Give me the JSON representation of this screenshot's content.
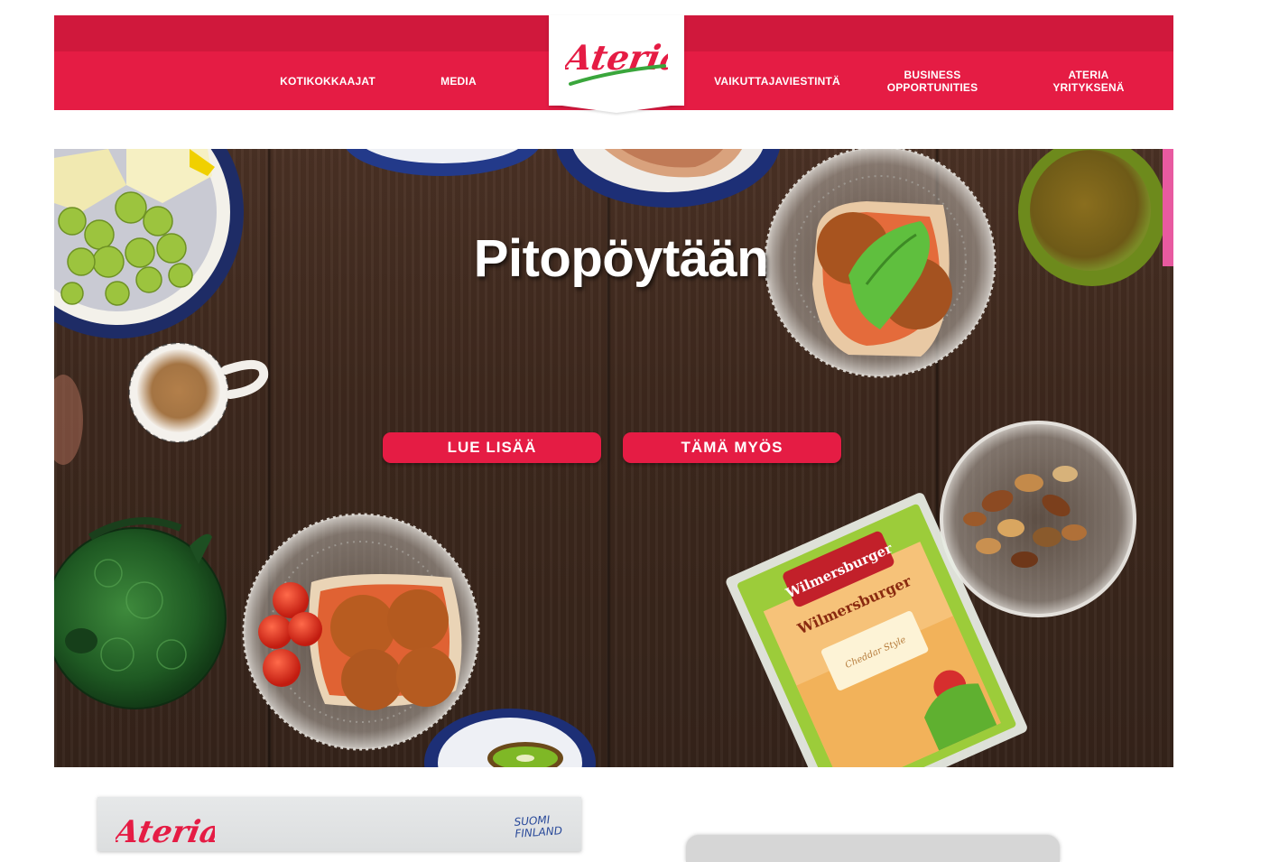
{
  "header": {
    "logo_text": "Ateria",
    "nav_left": [
      {
        "lines": [
          "KOTIKOKKAAJAT"
        ]
      },
      {
        "lines": [
          "MEDIA"
        ]
      }
    ],
    "nav_right": [
      {
        "lines": [
          "VAIKUTTAJAVIESTINTÄ"
        ]
      },
      {
        "lines": [
          "BUSINESS",
          "OPPORTUNITIES"
        ]
      },
      {
        "lines": [
          "ATERIA",
          "YRITYKSENÄ"
        ]
      }
    ],
    "brand_color": "#e51c44",
    "brand_color_dark": "#d0183c"
  },
  "hero": {
    "title": "Pitopöytään",
    "primary_button": "LUE LISÄÄ",
    "secondary_button": "TÄMÄ MYÖS",
    "package_brand": "Wilmersburger",
    "package_subtext": "Cheddar Style"
  },
  "promo": {
    "logo_text": "Ateria",
    "side_text_line1": "SUOMI",
    "side_text_line2": "FINLAND"
  }
}
